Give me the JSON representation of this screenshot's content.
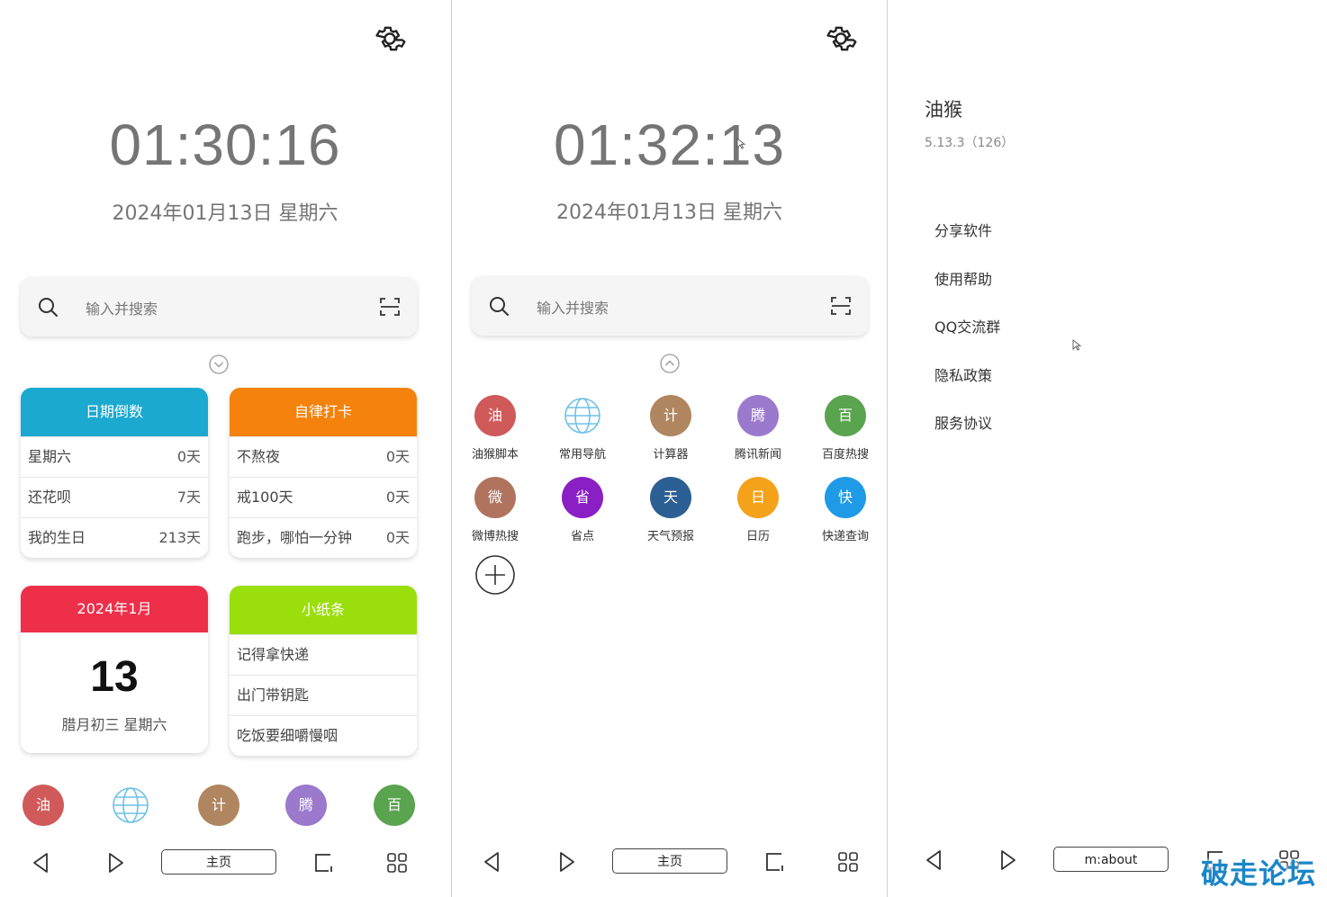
{
  "home1": {
    "time": "01:30:16",
    "date": "2024年01月13日 星期六",
    "search_placeholder": "输入并搜索",
    "countdown": {
      "title": "日期倒数",
      "rows": [
        {
          "label": "星期六",
          "value": "0天"
        },
        {
          "label": "还花呗",
          "value": "7天"
        },
        {
          "label": "我的生日",
          "value": "213天"
        }
      ]
    },
    "checkin": {
      "title": "自律打卡",
      "rows": [
        {
          "label": "不熬夜",
          "value": "0天"
        },
        {
          "label": "戒100天",
          "value": "0天"
        },
        {
          "label": "跑步，哪怕一分钟",
          "value": "0天"
        }
      ]
    },
    "calendar": {
      "title": "2024年1月",
      "day": "13",
      "sub": "腊月初三  星期六"
    },
    "notes": {
      "title": "小纸条",
      "items": [
        "记得拿快递",
        "出门带钥匙",
        "吃饭要细嚼慢咽"
      ]
    },
    "dock": [
      "油",
      "计",
      "腾",
      "百"
    ],
    "address": "主页"
  },
  "home2": {
    "time": "01:32:13",
    "date": "2024年01月13日 星期六",
    "search_placeholder": "输入并搜索",
    "apps": [
      {
        "glyph": "油",
        "label": "油猴脚本"
      },
      {
        "glyph": "",
        "label": "常用导航"
      },
      {
        "glyph": "计",
        "label": "计算器"
      },
      {
        "glyph": "腾",
        "label": "腾讯新闻"
      },
      {
        "glyph": "百",
        "label": "百度热搜"
      },
      {
        "glyph": "微",
        "label": "微博热搜"
      },
      {
        "glyph": "省",
        "label": "省点"
      },
      {
        "glyph": "天",
        "label": "天气预报"
      },
      {
        "glyph": "日",
        "label": "日历"
      },
      {
        "glyph": "快",
        "label": "快递查询"
      }
    ],
    "address": "主页"
  },
  "about": {
    "app_name": "油猴",
    "version": "5.13.3（126）",
    "menu": [
      "分享软件",
      "使用帮助",
      "QQ交流群",
      "隐私政策",
      "服务协议"
    ],
    "address": "m:about"
  },
  "watermark": "破走论坛",
  "colors": {
    "countdown_head": "#1ba9d0",
    "checkin_head": "#f4820c",
    "calendar_head": "#ee2f4a",
    "notes_head": "#9ade0c",
    "app_you": "#d05a5a",
    "app_calc": "#b08660",
    "app_teng": "#9b79cc",
    "app_bai": "#5aa34f",
    "app_wei": "#b0745e",
    "app_sheng": "#8a1fc4",
    "app_tian": "#2c5f94",
    "app_ri": "#f3a21a",
    "app_kuai": "#1e9ae6",
    "globe": "#6fc1e6"
  }
}
